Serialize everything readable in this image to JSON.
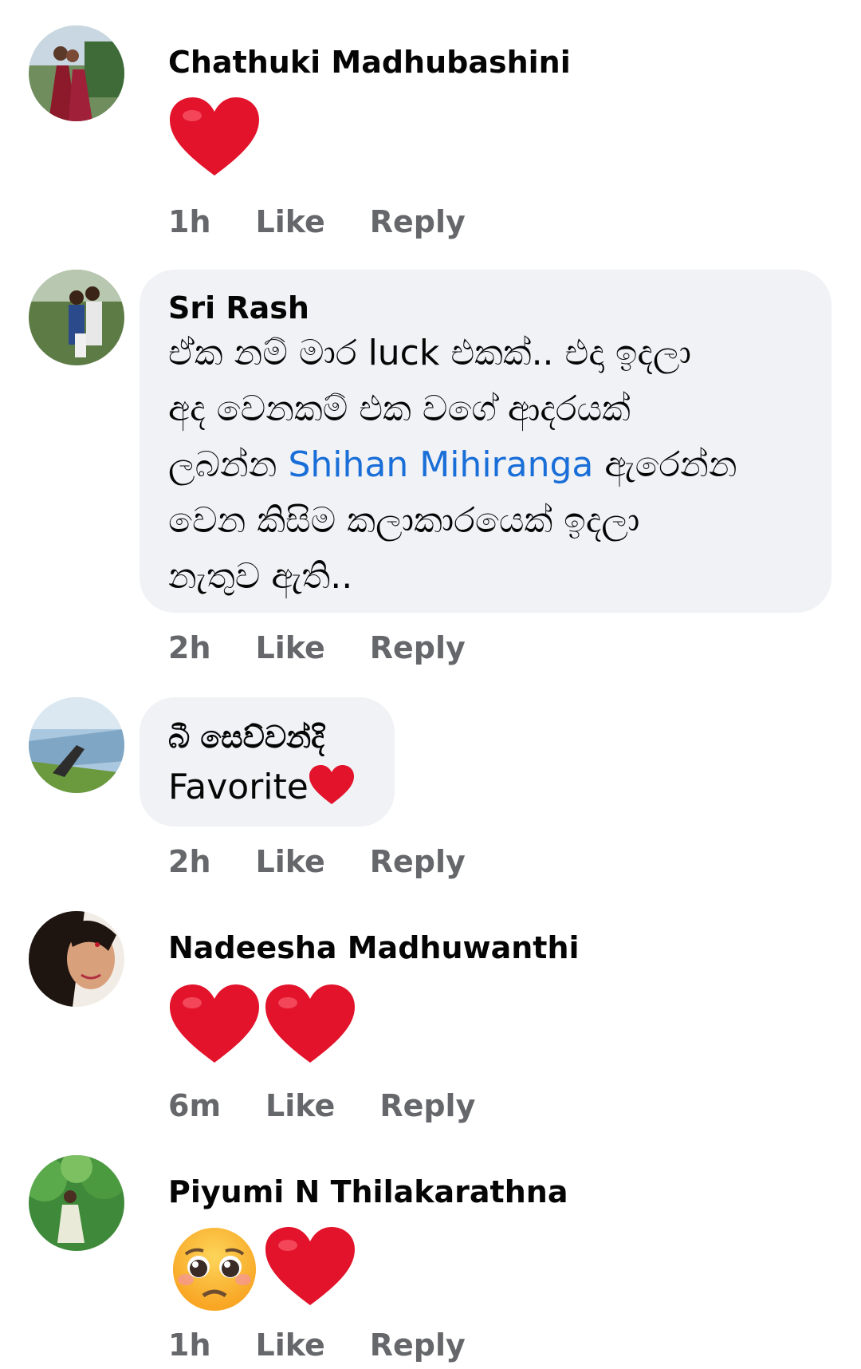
{
  "comments": [
    {
      "name": "Chathuki Madhubashini",
      "time": "1h",
      "like": "Like",
      "reply": "Reply",
      "reactions": [
        "heart"
      ]
    },
    {
      "name": "Sri Rash",
      "text_lines": [
        "ඒක නම් මාර luck එකක්.. එදා ඉදලා",
        "අද වෙනකම් එක වගේ ආදරයක්",
        "ලබන්න ",
        "වෙන කිසිම කලාකාරයෙක් ඉදලා",
        "නැතුව ඇති.."
      ],
      "mention": "Shihan Mihiranga",
      "line3_after": " ඇරෙන්න",
      "time": "2h",
      "like": "Like",
      "reply": "Reply"
    },
    {
      "name": "බී සෙව්වන්දි",
      "text": "Favorite",
      "time": "2h",
      "like": "Like",
      "reply": "Reply"
    },
    {
      "name": "Nadeesha Madhuwanthi",
      "time": "6m",
      "like": "Like",
      "reply": "Reply",
      "reactions": [
        "heart",
        "heart"
      ]
    },
    {
      "name": "Piyumi N Thilakarathna",
      "time": "1h",
      "like": "Like",
      "reply": "Reply",
      "reactions": [
        "pleading-face",
        "heart"
      ]
    }
  ],
  "colors": {
    "mention": "#1a6ed8",
    "meta": "#65676b",
    "bubble": "#f0f2f5",
    "heart": "#e2132b"
  }
}
